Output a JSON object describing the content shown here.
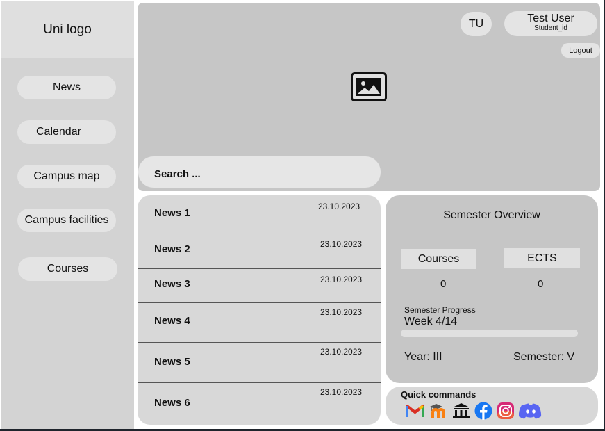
{
  "sidebar": {
    "logo": "Uni logo",
    "items": [
      {
        "label": "News"
      },
      {
        "label": "Calendar"
      },
      {
        "label": "Campus map"
      },
      {
        "label": "Campus facilities"
      },
      {
        "label": "Courses"
      }
    ]
  },
  "header": {
    "avatar_initials": "TU",
    "user_name": "Test User",
    "user_id": "Student_id",
    "logout_label": "Logout",
    "banner_icon": "image-icon"
  },
  "search": {
    "placeholder": "Search ..."
  },
  "news": [
    {
      "title": "News 1",
      "date": "23.10.2023"
    },
    {
      "title": "News 2",
      "date": "23.10.2023"
    },
    {
      "title": "News 3",
      "date": "23.10.2023"
    },
    {
      "title": "News 4",
      "date": "23.10.2023"
    },
    {
      "title": "News 5",
      "date": "23.10.2023"
    },
    {
      "title": "News 6",
      "date": "23.10.2023"
    }
  ],
  "semester": {
    "title": "Semester Overview",
    "courses_label": "Courses",
    "courses_value": "0",
    "ects_label": "ECTS",
    "ects_value": "0",
    "progress_label": "Semester Progress",
    "progress_text": "Week 4/14",
    "progress_fraction": 0.0,
    "year": "Year: III",
    "semester": "Semester: V"
  },
  "quick_commands": {
    "title": "Quick commands",
    "icons": [
      "gmail-icon",
      "moodle-icon",
      "university-icon",
      "facebook-icon",
      "instagram-icon",
      "discord-icon"
    ]
  }
}
